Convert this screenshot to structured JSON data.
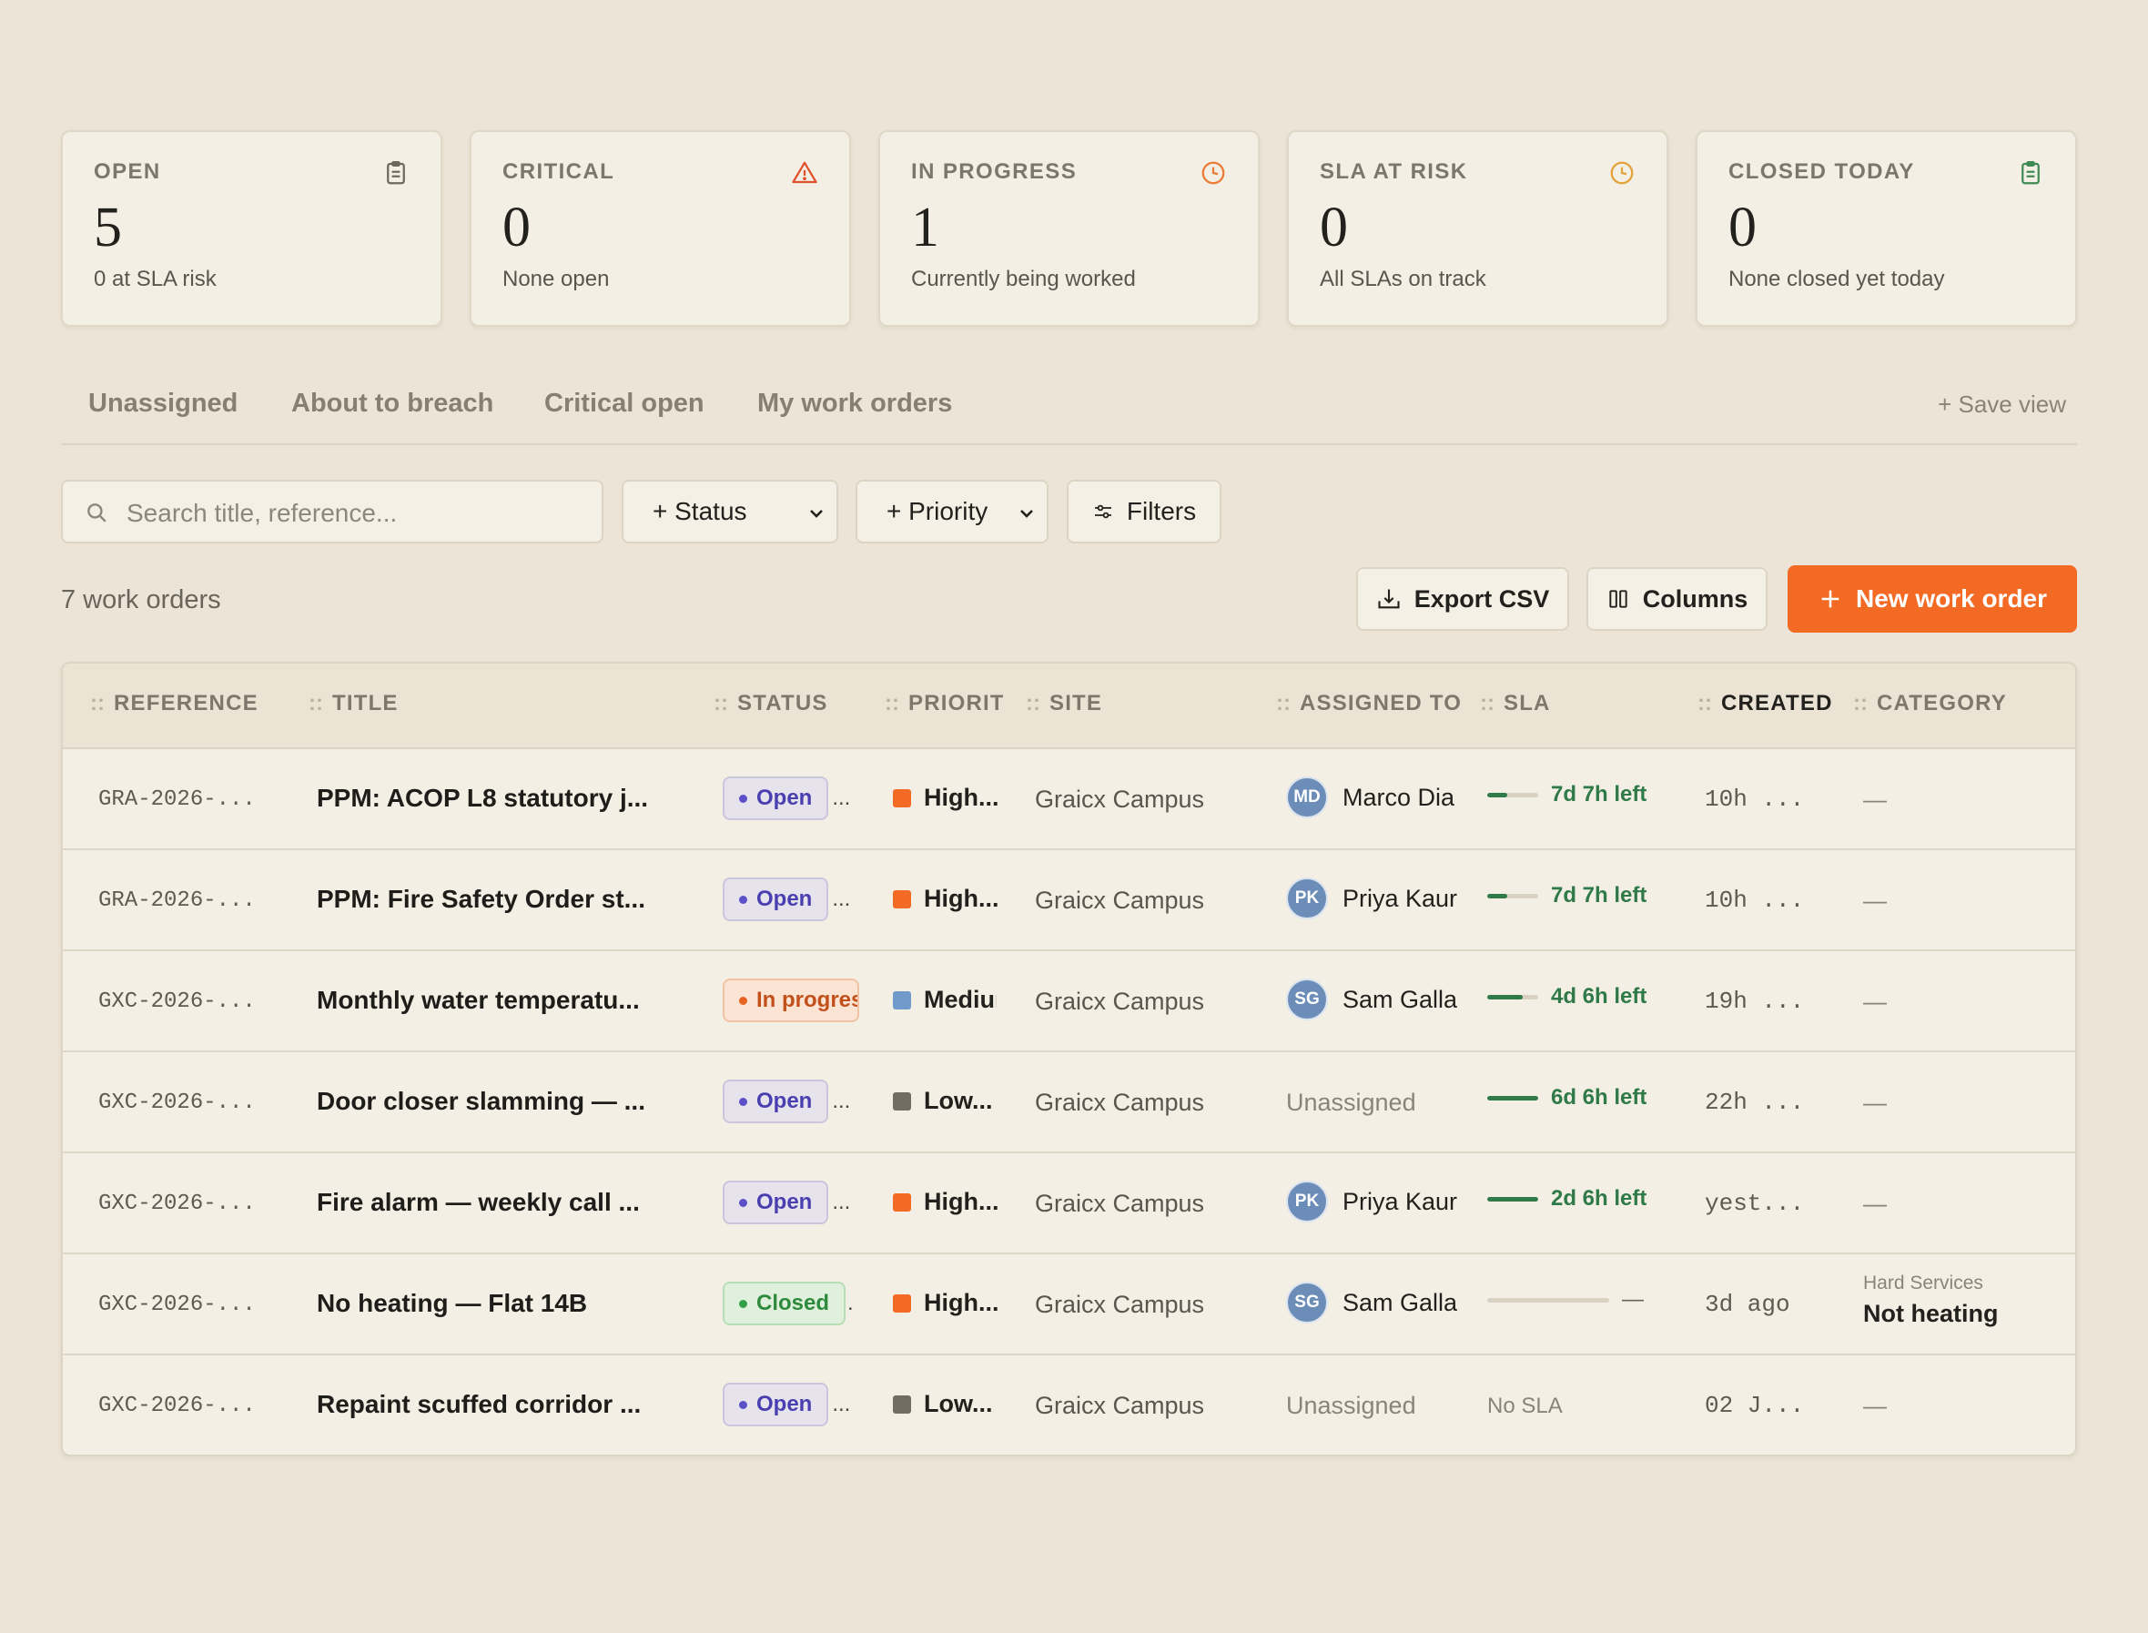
{
  "stats": [
    {
      "label": "OPEN",
      "value": "5",
      "sub": "0 at SLA risk",
      "icon": "clipboard-icon",
      "icon_color": "#6d675c"
    },
    {
      "label": "CRITICAL",
      "value": "0",
      "sub": "None open",
      "icon": "warning-icon",
      "icon_color": "#e0522d"
    },
    {
      "label": "IN PROGRESS",
      "value": "1",
      "sub": "Currently being worked",
      "icon": "clock-icon",
      "icon_color": "#ea7a34"
    },
    {
      "label": "SLA AT RISK",
      "value": "0",
      "sub": "All SLAs on track",
      "icon": "clock-icon",
      "icon_color": "#e3a23a"
    },
    {
      "label": "CLOSED TODAY",
      "value": "0",
      "sub": "None closed yet today",
      "icon": "clipboard-icon",
      "icon_color": "#3f8a55"
    }
  ],
  "views": {
    "tabs": [
      "Unassigned",
      "About to breach",
      "Critical open",
      "My work orders"
    ],
    "save_view": "+ Save view"
  },
  "filters": {
    "search_placeholder": "Search title, reference...",
    "status": "+ Status",
    "priority": "+ Priority",
    "filters": "Filters"
  },
  "toolbar": {
    "count": "7 work orders",
    "export": "Export CSV",
    "columns": "Columns",
    "new": "New work order"
  },
  "table": {
    "headers": [
      "REFERENCE",
      "TITLE",
      "STATUS",
      "PRIORIT",
      "SITE",
      "ASSIGNED TO",
      "SLA",
      "CREATED",
      "CATEGORY"
    ],
    "rows": [
      {
        "ref": "GRA-2026-...",
        "title": "PPM: ACOP L8 statutory j...",
        "status": "Open",
        "status_type": "open",
        "priority": "High...",
        "priority_color": "#f26a23",
        "site": "Graicx Campus",
        "initials": "MD",
        "assignee": "Marco Dia",
        "sla": "7d 7h left",
        "sla_fill": 0.4,
        "created": "10h ...",
        "category": "—"
      },
      {
        "ref": "GRA-2026-...",
        "title": "PPM: Fire Safety Order st...",
        "status": "Open",
        "status_type": "open",
        "priority": "High...",
        "priority_color": "#f26a23",
        "site": "Graicx Campus",
        "initials": "PK",
        "assignee": "Priya Kaur",
        "sla": "7d 7h left",
        "sla_fill": 0.4,
        "created": "10h ...",
        "category": "—"
      },
      {
        "ref": "GXC-2026-...",
        "title": "Monthly water temperatu...",
        "status": "In progress",
        "status_type": "prog",
        "priority": "Medium",
        "priority_color": "#6f9ac9",
        "site": "Graicx Campus",
        "initials": "SG",
        "assignee": "Sam Galla",
        "sla": "4d 6h left",
        "sla_fill": 0.7,
        "created": "19h ...",
        "category": "—"
      },
      {
        "ref": "GXC-2026-...",
        "title": "Door closer slamming — ...",
        "status": "Open",
        "status_type": "open",
        "priority": "Low...",
        "priority_color": "#726c62",
        "site": "Graicx Campus",
        "initials": "",
        "assignee": "Unassigned",
        "sla": "6d 6h left",
        "sla_fill": 1.0,
        "created": "22h ...",
        "category": "—"
      },
      {
        "ref": "GXC-2026-...",
        "title": "Fire alarm — weekly call ...",
        "status": "Open",
        "status_type": "open",
        "priority": "High...",
        "priority_color": "#f26a23",
        "site": "Graicx Campus",
        "initials": "PK",
        "assignee": "Priya Kaur",
        "sla": "2d 6h left",
        "sla_fill": 1.0,
        "created": "yest...",
        "category": "—"
      },
      {
        "ref": "GXC-2026-...",
        "title": "No heating — Flat 14B",
        "status": "Closed",
        "status_type": "closed",
        "priority": "High...",
        "priority_color": "#f26a23",
        "site": "Graicx Campus",
        "initials": "SG",
        "assignee": "Sam Galla",
        "sla": "—",
        "sla_fill": 0,
        "created": "3d ago",
        "category_group": "Hard Services",
        "category": "Not heating"
      },
      {
        "ref": "GXC-2026-...",
        "title": "Repaint scuffed corridor ...",
        "status": "Open",
        "status_type": "open",
        "priority": "Low...",
        "priority_color": "#726c62",
        "site": "Graicx Campus",
        "initials": "",
        "assignee": "Unassigned",
        "sla": "No SLA",
        "sla_fill": null,
        "created": "02 J...",
        "category": "—"
      }
    ]
  }
}
